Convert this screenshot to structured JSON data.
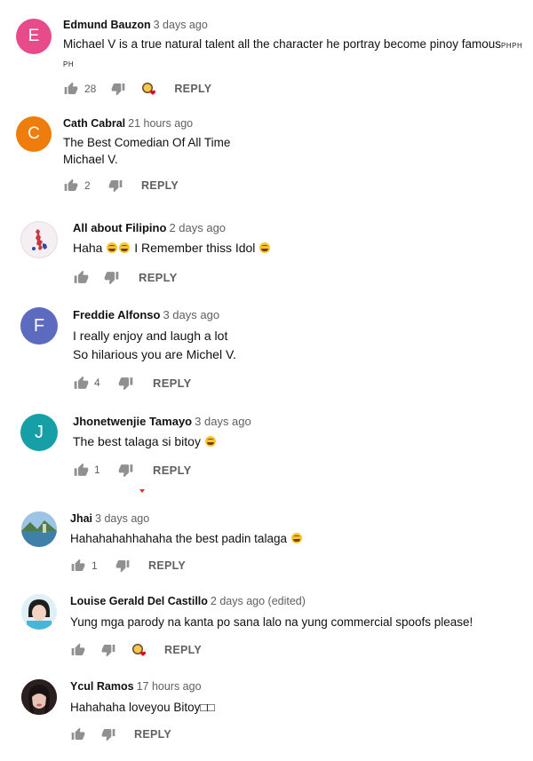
{
  "reply_label": "REPLY",
  "comments": [
    {
      "author": "Edmund Bauzon",
      "time": "3 days ago",
      "avatar_letter": "E",
      "avatar_color": "#e84b8a",
      "line1": "Michael V is a true natural talent all the character he portray become pinoy famous",
      "tail1": "PHPH",
      "line2": "PH",
      "likes": "28"
    },
    {
      "author": "Cath Cabral",
      "time": "21 hours ago",
      "avatar_letter": "C",
      "avatar_color": "#ef7d0c",
      "line1": "The Best Comedian Of All Time",
      "line2": "Michael V.",
      "likes": "2"
    },
    {
      "author": "All about Filipino",
      "time": "2 days ago",
      "avatar_letter": "",
      "avatar_color": "#f3e9f0",
      "line1a": "Haha",
      "line1b": "I Remember thiss Idol",
      "likes": ""
    },
    {
      "author": "Freddie Alfonso",
      "time": "3 days ago",
      "avatar_letter": "F",
      "avatar_color": "#5c6bc0",
      "line1": "I really enjoy and laugh a lot",
      "line2": "So hilarious you are Michel V.",
      "likes": "4"
    },
    {
      "author": "Jhonetwenjie Tamayo",
      "time": "3 days ago",
      "avatar_letter": "J",
      "avatar_color": "#169fa6",
      "line1": "The best talaga si bitoy",
      "likes": "1"
    },
    {
      "author": "Jhai",
      "time": "3 days ago",
      "avatar_letter": "",
      "avatar_color": "#7aa6c9",
      "line1": "Hahahahahhahaha the best padin talaga",
      "likes": "1"
    },
    {
      "author": "Louise Gerald Del Castillo",
      "time": "2 days ago (edited)",
      "avatar_letter": "",
      "avatar_color": "#2d2d2d",
      "line1": "Yung mga parody na kanta po sana lalo na yung commercial spoofs please!",
      "likes": ""
    },
    {
      "author": "Ycul Ramos",
      "time": "17 hours ago",
      "avatar_letter": "",
      "avatar_color": "#3a2a2a",
      "line1": "Hahahaha loveyou Bitoy□□",
      "likes": ""
    }
  ]
}
